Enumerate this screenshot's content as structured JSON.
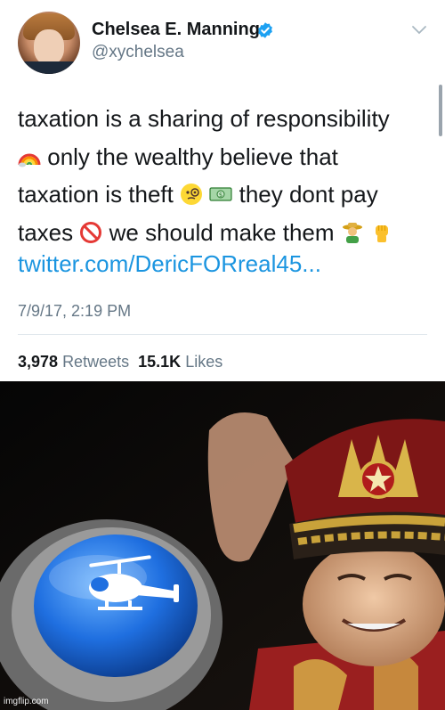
{
  "tweet": {
    "display_name": "Chelsea E. Manning",
    "handle": "@xychelsea",
    "text_lines": [
      "taxation is a sharing of responsibility",
      "only the wealthy believe that",
      "taxation is theft",
      "they dont pay",
      "taxes",
      "we should make them"
    ],
    "link": "twitter.com/DericFORreal45...",
    "timestamp": "7/9/17, 2:19 PM",
    "retweet_count": "3,978",
    "retweet_label": "Retweets",
    "like_count": "15.1K",
    "like_label": "Likes",
    "icons": [
      "verified-badge-icon",
      "chevron-down-icon",
      "rainbow-emoji",
      "face-with-monocle-emoji",
      "dollar-banknote-emoji",
      "prohibited-emoji",
      "farmer-emoji",
      "raised-fist-emoji"
    ],
    "colors": {
      "link": "#1b95e0",
      "verified": "#1da1f2",
      "muted": "#657786"
    }
  },
  "meme": {
    "description_icons": [
      "helicopter-button-icon",
      "saluting-general"
    ],
    "watermark": "imgflip.com"
  }
}
